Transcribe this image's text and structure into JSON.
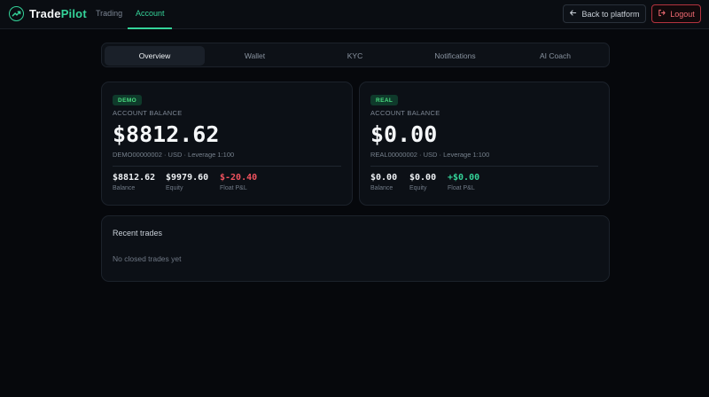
{
  "header": {
    "brand_a": "Trade",
    "brand_b": "Pilot",
    "brand_icon": "trend-line-icon",
    "nav": [
      {
        "label": "Trading",
        "active": false
      },
      {
        "label": "Account",
        "active": true
      }
    ],
    "back_label": "Back to platform",
    "back_icon": "arrow-left-icon",
    "logout_label": "Logout",
    "logout_icon": "logout-icon"
  },
  "tabs": [
    {
      "label": "Overview",
      "active": true
    },
    {
      "label": "Wallet",
      "active": false
    },
    {
      "label": "KYC",
      "active": false
    },
    {
      "label": "Notifications",
      "active": false
    },
    {
      "label": "AI Coach",
      "active": false
    }
  ],
  "accounts": {
    "demo": {
      "badge": "DEMO",
      "heading": "ACCOUNT BALANCE",
      "balance": "$8812.62",
      "meta": "DEMO00000002 · USD · Leverage 1:100",
      "stats": [
        {
          "value": "$8812.62",
          "label": "Balance"
        },
        {
          "value": "$9979.60",
          "label": "Equity"
        },
        {
          "value": "$-20.40",
          "label": "Float P&L"
        }
      ]
    },
    "real": {
      "badge": "REAL",
      "heading": "ACCOUNT BALANCE",
      "balance": "$0.00",
      "meta": "REAL00000002 · USD · Leverage 1:100",
      "stats": [
        {
          "value": "$0.00",
          "label": "Balance"
        },
        {
          "value": "$0.00",
          "label": "Equity"
        },
        {
          "value": "+$0.00",
          "label": "Float P&L"
        }
      ]
    }
  },
  "recent": {
    "title": "Recent trades",
    "empty": "No closed trades yet"
  },
  "colors": {
    "accent": "#34d399",
    "negative": "#f0525e",
    "logout": "#f06a72",
    "background": "#06080c"
  }
}
